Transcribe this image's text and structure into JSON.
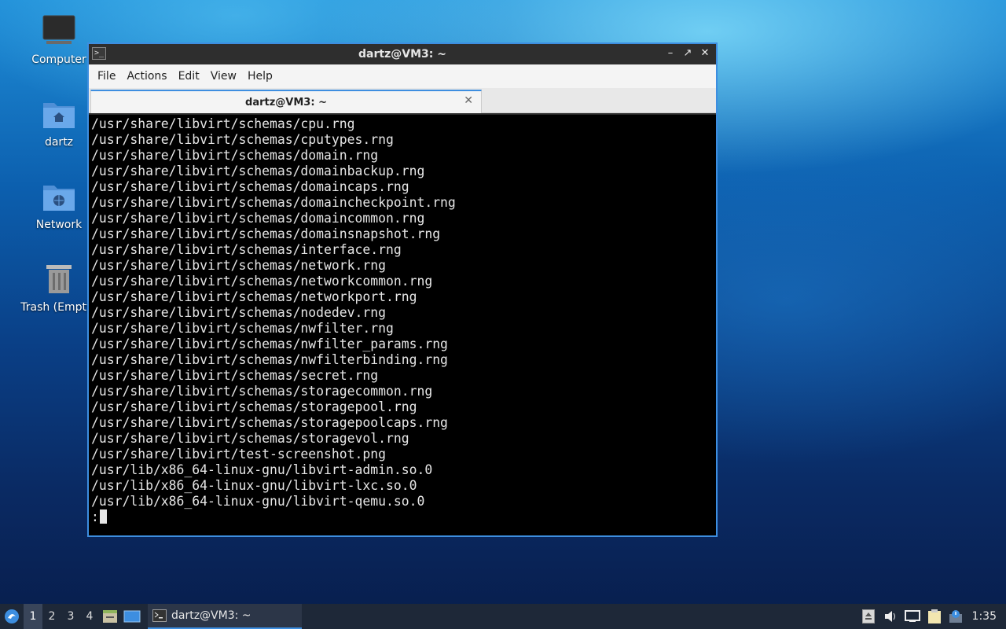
{
  "desktop": {
    "icons": [
      {
        "label": "Computer"
      },
      {
        "label": "dartz"
      },
      {
        "label": "Network"
      },
      {
        "label": "Trash (Empty)"
      }
    ]
  },
  "window": {
    "title": "dartz@VM3: ~",
    "menu": [
      "File",
      "Actions",
      "Edit",
      "View",
      "Help"
    ],
    "tab_title": "dartz@VM3: ~",
    "terminal_lines": [
      "/usr/share/libvirt/schemas/cpu.rng",
      "/usr/share/libvirt/schemas/cputypes.rng",
      "/usr/share/libvirt/schemas/domain.rng",
      "/usr/share/libvirt/schemas/domainbackup.rng",
      "/usr/share/libvirt/schemas/domaincaps.rng",
      "/usr/share/libvirt/schemas/domaincheckpoint.rng",
      "/usr/share/libvirt/schemas/domaincommon.rng",
      "/usr/share/libvirt/schemas/domainsnapshot.rng",
      "/usr/share/libvirt/schemas/interface.rng",
      "/usr/share/libvirt/schemas/network.rng",
      "/usr/share/libvirt/schemas/networkcommon.rng",
      "/usr/share/libvirt/schemas/networkport.rng",
      "/usr/share/libvirt/schemas/nodedev.rng",
      "/usr/share/libvirt/schemas/nwfilter.rng",
      "/usr/share/libvirt/schemas/nwfilter_params.rng",
      "/usr/share/libvirt/schemas/nwfilterbinding.rng",
      "/usr/share/libvirt/schemas/secret.rng",
      "/usr/share/libvirt/schemas/storagecommon.rng",
      "/usr/share/libvirt/schemas/storagepool.rng",
      "/usr/share/libvirt/schemas/storagepoolcaps.rng",
      "/usr/share/libvirt/schemas/storagevol.rng",
      "/usr/share/libvirt/test-screenshot.png",
      "/usr/lib/x86_64-linux-gnu/libvirt-admin.so.0",
      "/usr/lib/x86_64-linux-gnu/libvirt-lxc.so.0",
      "/usr/lib/x86_64-linux-gnu/libvirt-qemu.so.0"
    ],
    "prompt": ":"
  },
  "taskbar": {
    "workspaces": [
      "1",
      "2",
      "3",
      "4"
    ],
    "active_workspace": "1",
    "task_label": "dartz@VM3: ~",
    "clock": "1:35",
    "icons": [
      "start-menu-icon",
      "file-manager-icon",
      "show-desktop-icon",
      "terminal-icon",
      "eject-icon",
      "volume-icon",
      "network-icon",
      "clipboard-icon",
      "notification-icon"
    ]
  },
  "colors": {
    "accent": "#3d8ee0",
    "terminal_bg": "#000000",
    "terminal_fg": "#e6e6e6",
    "taskbar_bg": "#1e2838"
  }
}
